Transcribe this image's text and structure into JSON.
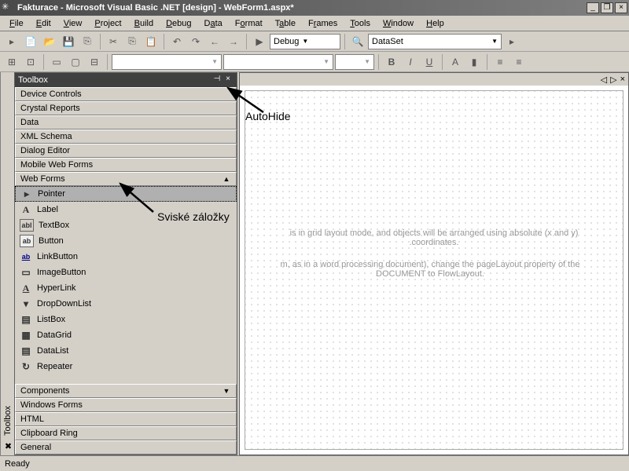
{
  "window": {
    "title": "Fakturace - Microsoft Visual Basic .NET [design] - WebForm1.aspx*"
  },
  "menus": [
    "File",
    "Edit",
    "View",
    "Project",
    "Build",
    "Debug",
    "Data",
    "Format",
    "Table",
    "Frames",
    "Tools",
    "Window",
    "Help"
  ],
  "toolbar1": {
    "config_combo": "Debug",
    "target_combo": "DataSet"
  },
  "toolbox": {
    "title": "Toolbox",
    "categories_top": [
      "Device Controls",
      "Crystal Reports",
      "Data",
      "XML Schema",
      "Dialog Editor",
      "Mobile Web Forms",
      "Web Forms"
    ],
    "items": [
      {
        "icon": "▸",
        "label": "Pointer",
        "selected": true
      },
      {
        "icon": "A",
        "label": "Label"
      },
      {
        "icon": "ab|",
        "label": "TextBox"
      },
      {
        "icon": "ab",
        "label": "Button"
      },
      {
        "icon": "ab",
        "label": "LinkButton"
      },
      {
        "icon": "▭",
        "label": "ImageButton"
      },
      {
        "icon": "A",
        "label": "HyperLink"
      },
      {
        "icon": "▾",
        "label": "DropDownList"
      },
      {
        "icon": "▤",
        "label": "ListBox"
      },
      {
        "icon": "▦",
        "label": "DataGrid"
      },
      {
        "icon": "▤",
        "label": "DataList"
      },
      {
        "icon": "↻",
        "label": "Repeater"
      }
    ],
    "categories_bottom": [
      "Components",
      "Windows Forms",
      "HTML",
      "Clipboard Ring",
      "General"
    ]
  },
  "sidetab": {
    "label": "Toolbox"
  },
  "designer": {
    "hint1": "is in grid layout mode, and objects will be arranged using absolute (x and y)",
    "hint1b": ".coordinates.",
    "hint2": "m, as in a word processing document), change the pageLayout property of the",
    "hint2b": "DOCUMENT to FlowLayout."
  },
  "annotations": {
    "autohide": "AutoHide",
    "zalozky": "Sviské záložky"
  },
  "status": {
    "text": "Ready"
  }
}
